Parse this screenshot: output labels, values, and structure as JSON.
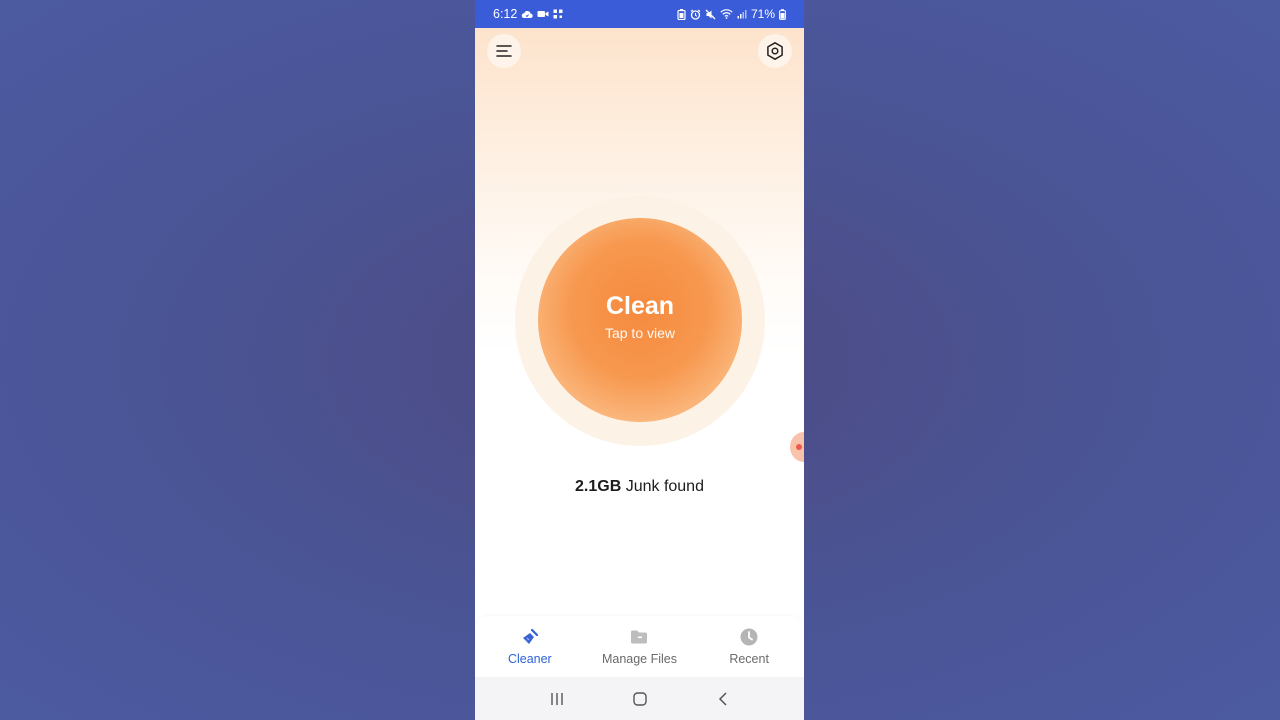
{
  "status_bar": {
    "time": "6:12",
    "battery": "71%"
  },
  "header": {
    "menu_icon": "menu-icon",
    "settings_icon": "settings-hex-icon"
  },
  "clean_button": {
    "title": "Clean",
    "subtitle": "Tap to view"
  },
  "junk": {
    "size": "2.1GB",
    "label": " Junk found"
  },
  "bottom_nav": {
    "items": [
      {
        "label": "Cleaner",
        "icon": "broom-icon",
        "active": true
      },
      {
        "label": "Manage Files",
        "icon": "folder-icon",
        "active": false
      },
      {
        "label": "Recent",
        "icon": "clock-icon",
        "active": false
      }
    ]
  },
  "colors": {
    "accent": "#f58a3e",
    "status_bar": "#3a5cd8",
    "nav_active": "#2f63d6"
  }
}
